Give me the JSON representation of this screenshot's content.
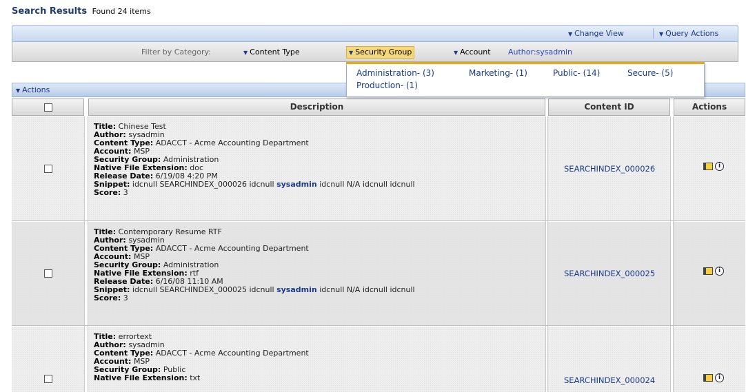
{
  "header": {
    "title": "Search Results",
    "found_text": "Found 24 items"
  },
  "toolbar": {
    "change_view": "Change View",
    "query_actions": "Query Actions"
  },
  "filter": {
    "label": "Filter by Category:",
    "content_type": "Content Type",
    "security_group": "Security Group",
    "account": "Account",
    "author": "Author:sysadmin"
  },
  "security_group_menu": [
    "Administration- (3)",
    "Marketing- (1)",
    "Public- (14)",
    "Secure- (5)",
    "Production- (1)"
  ],
  "actions_bar": {
    "label": "Actions"
  },
  "table": {
    "headers": {
      "description": "Description",
      "content_id": "Content ID",
      "actions": "Actions"
    },
    "field_labels": {
      "title": "Title:",
      "author": "Author:",
      "content_type": "Content Type:",
      "account": "Account:",
      "security_group": "Security Group:",
      "native_file_extension": "Native File Extension:",
      "release_date": "Release Date:",
      "snippet": "Snippet:",
      "score": "Score:"
    },
    "rows": [
      {
        "title": "Chinese Test",
        "author": "sysadmin",
        "content_type": "ADACCT - Acme Accounting Department",
        "account": "MSP",
        "security_group": "Administration",
        "native_file_extension": "doc",
        "release_date": "6/19/08 4:20 PM",
        "snippet_pre": "idcnull SEARCHINDEX_000026 idcnull",
        "snippet_hl": "sysadmin",
        "snippet_post": "idcnull N/A idcnull idcnull",
        "score": "3",
        "content_id": "SEARCHINDEX_000026"
      },
      {
        "title": "Contemporary Resume RTF",
        "author": "sysadmin",
        "content_type": "ADACCT - Acme Accounting Department",
        "account": "MSP",
        "security_group": "Administration",
        "native_file_extension": "rtf",
        "release_date": "6/16/08 11:10 AM",
        "snippet_pre": "idcnull SEARCHINDEX_000025 idcnull",
        "snippet_hl": "sysadmin",
        "snippet_post": "idcnull N/A idcnull idcnull",
        "score": "3",
        "content_id": "SEARCHINDEX_000025"
      },
      {
        "title": "errortext",
        "author": "sysadmin",
        "content_type": "ADACCT - Acme Accounting Department",
        "account": "MSP",
        "security_group": "Public",
        "native_file_extension": "txt",
        "content_id": "SEARCHINDEX_000024"
      }
    ]
  }
}
